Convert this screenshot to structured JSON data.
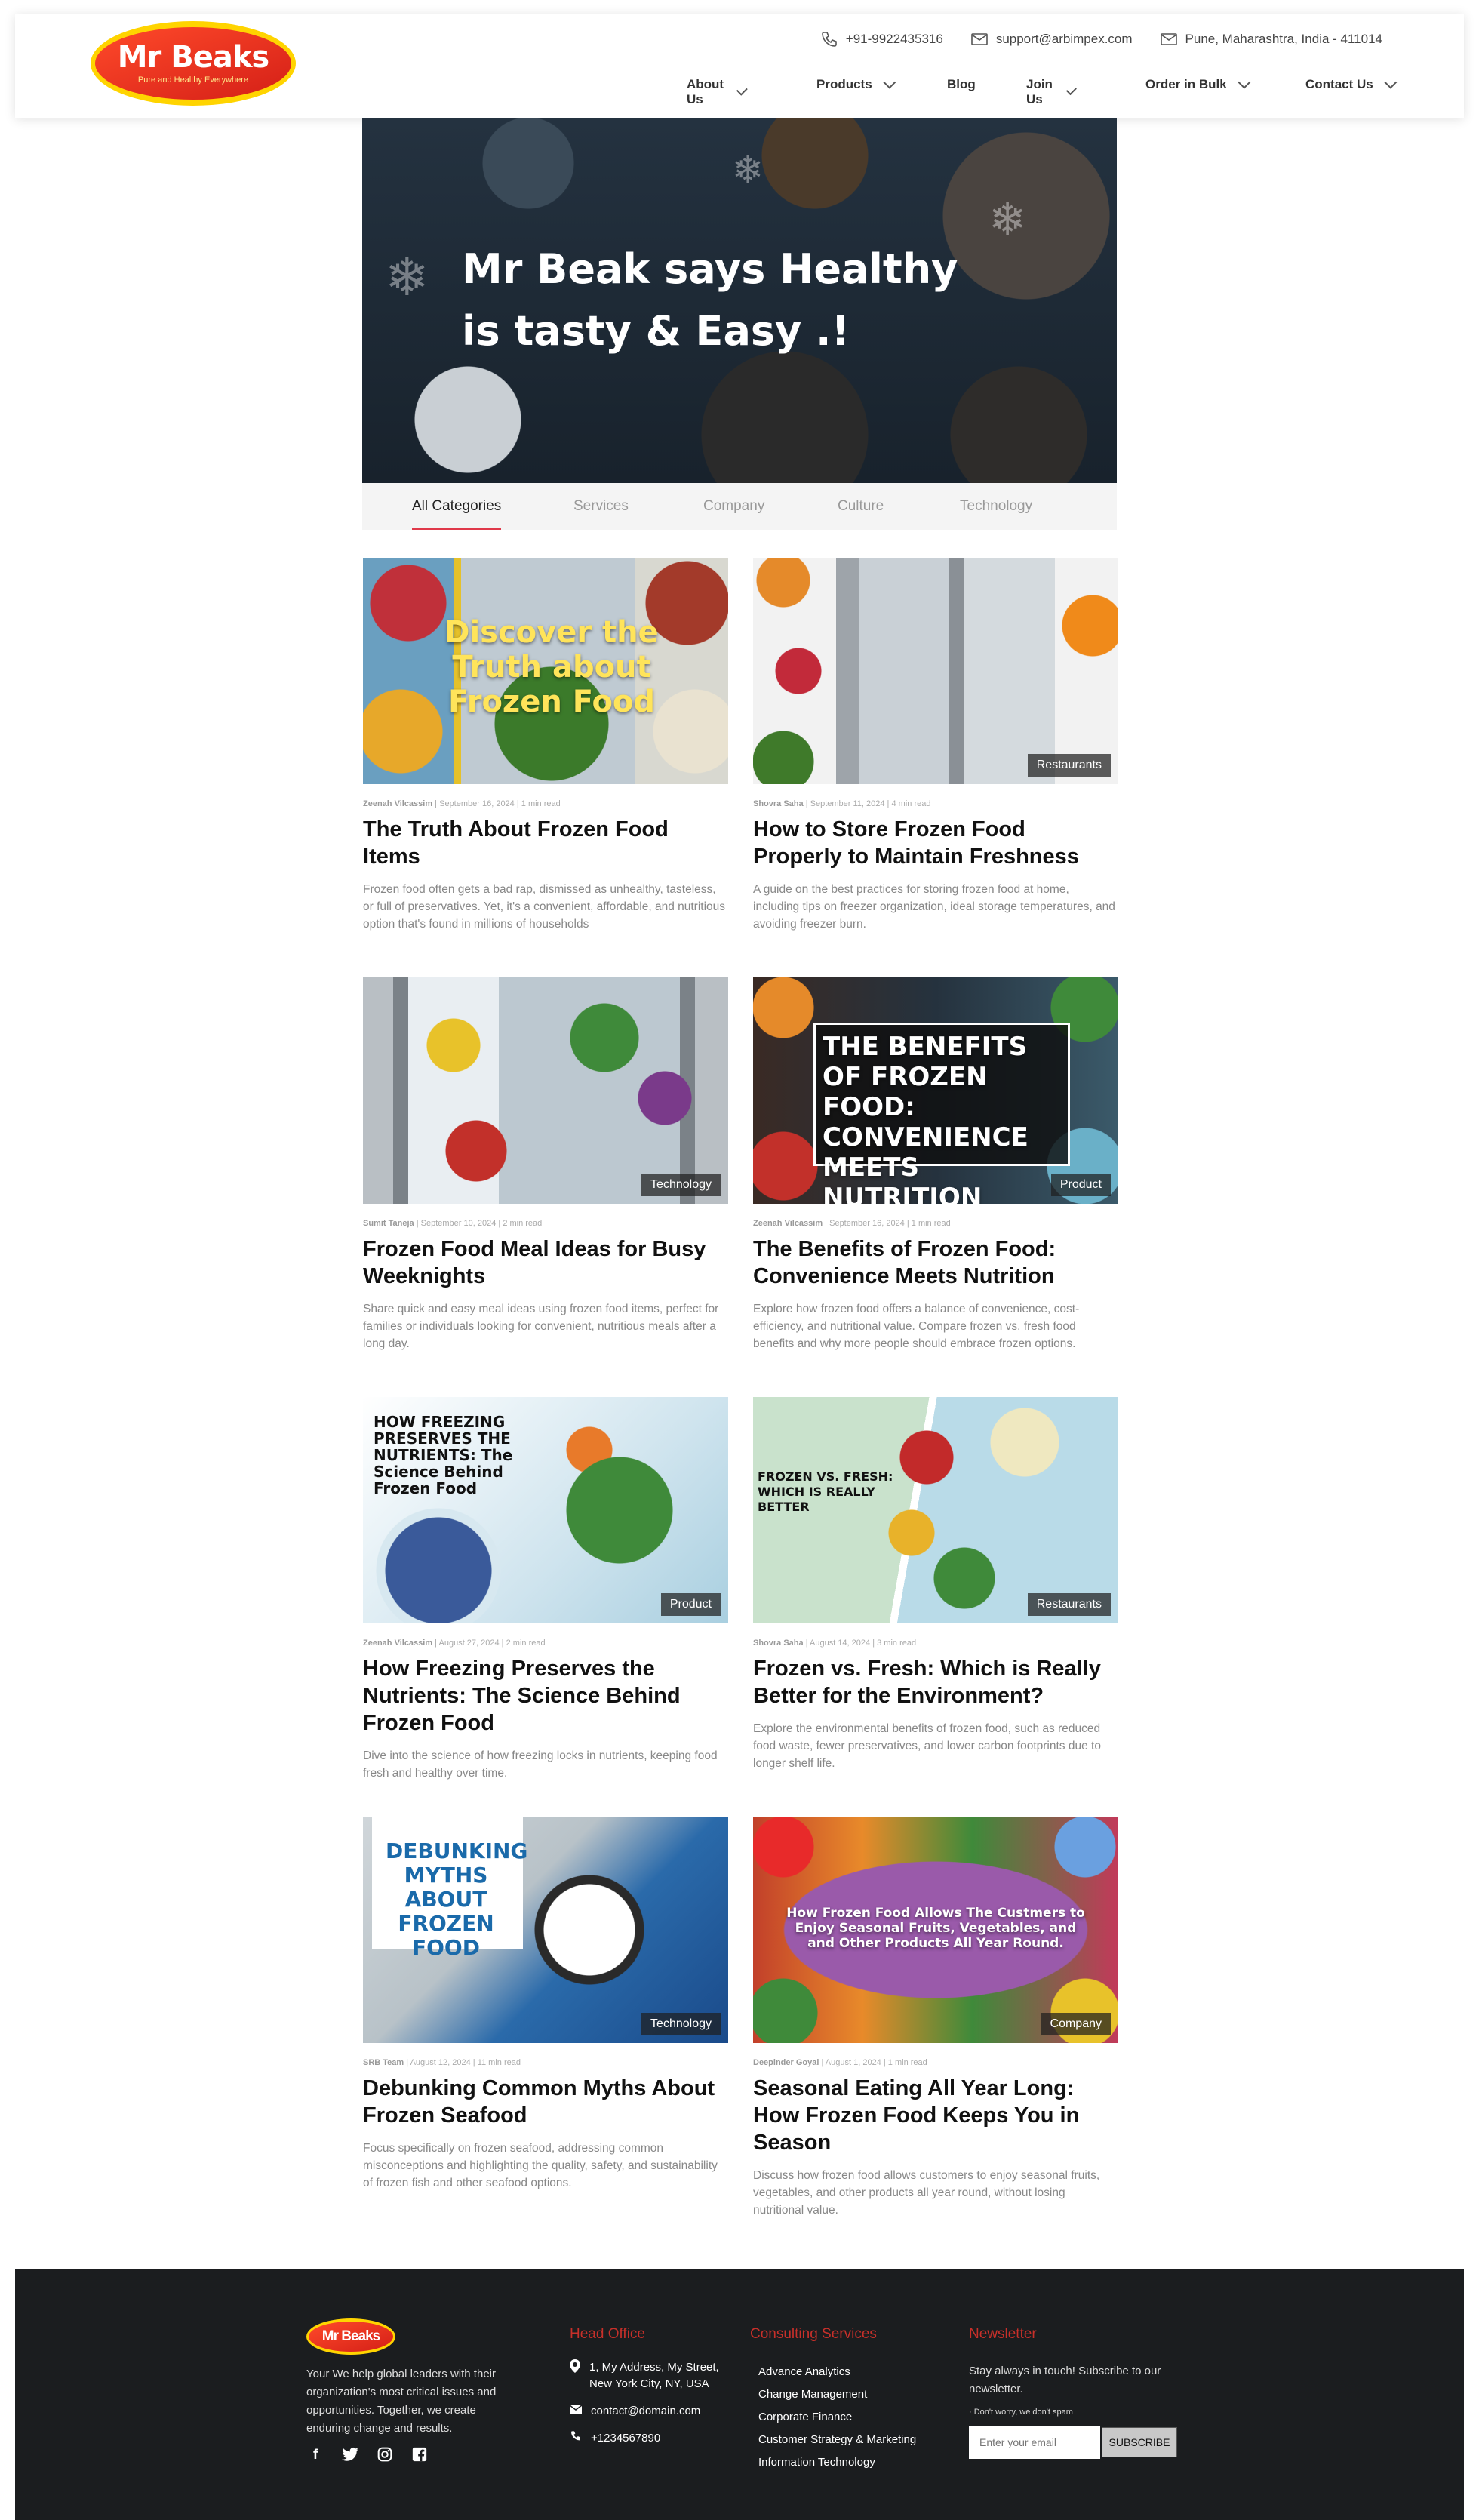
{
  "header": {
    "logo_name": "Mr Beaks",
    "logo_tagline": "Pure and Healthy Everywhere",
    "phone": "+91-9922435316",
    "email": "support@arbimpex.com",
    "location": "Pune, Maharashtra,  India - 411014",
    "nav": [
      {
        "label": "About Us",
        "dropdown": true
      },
      {
        "label": "Products",
        "dropdown": true
      },
      {
        "label": "Blog",
        "dropdown": false
      },
      {
        "label": "Join Us",
        "dropdown": true
      },
      {
        "label": "Order in Bulk",
        "dropdown": true
      },
      {
        "label": "Contact Us",
        "dropdown": true
      }
    ]
  },
  "hero": {
    "heading": "Mr Beak says Healthy is tasty & Easy .!"
  },
  "tabs": [
    "All Categories",
    "Services",
    "Company",
    "Culture",
    "Technology"
  ],
  "posts": [
    {
      "image_text": "Discover the Truth about Frozen Food",
      "badge": "",
      "author": "Zeenah Vilcassim",
      "date": "September 16, 2024",
      "read": "1 min read",
      "title": "The Truth About Frozen Food Items",
      "excerpt": "Frozen food often gets a bad rap, dismissed as unhealthy, tasteless, or full of preservatives. Yet, it's a convenient, affordable, and nutritious option that's found in millions of households"
    },
    {
      "image_text": "",
      "badge": "Restaurants",
      "author": "Shovra Saha",
      "date": "September 11, 2024",
      "read": "4 min read",
      "title": "How to Store Frozen Food Properly to Maintain Freshness",
      "excerpt": "A guide on the best practices for storing frozen food at home, including tips on freezer organization, ideal storage temperatures, and avoiding freezer burn."
    },
    {
      "image_text": "",
      "badge": "Technology",
      "author": "Sumit Taneja",
      "date": "September 10, 2024",
      "read": "2 min read",
      "title": "Frozen Food Meal Ideas for Busy Weeknights",
      "excerpt": "Share quick and easy meal ideas using frozen food items, perfect for families or individuals looking for convenient, nutritious meals after a long day."
    },
    {
      "image_text": "THE BENEFITS OF FROZEN FOOD: CONVENIENCE MEETS NUTRITION",
      "badge": "Product",
      "author": "Zeenah Vilcassim",
      "date": "September 16, 2024",
      "read": "1 min read",
      "title": "The Benefits of Frozen Food: Convenience Meets Nutrition",
      "excerpt": "Explore how frozen food offers a balance of convenience, cost-efficiency, and nutritional value. Compare frozen vs. fresh food benefits and why more people should embrace frozen options."
    },
    {
      "image_text": "HOW FREEZING PRESERVES THE NUTRIENTS: The Science Behind Frozen Food",
      "badge": "Product",
      "author": "Zeenah Vilcassim",
      "date": "August 27, 2024",
      "read": "2 min read",
      "title": "How Freezing Preserves the Nutrients: The Science Behind Frozen Food",
      "excerpt": "Dive into the science of how freezing locks in nutrients, keeping food fresh and healthy over time."
    },
    {
      "image_text": "FROZEN VS. FRESH: WHICH IS REALLY BETTER",
      "badge": "Restaurants",
      "author": "Shovra Saha",
      "date": "August 14, 2024",
      "read": "3 min read",
      "title": "Frozen vs. Fresh: Which is Really Better for the Environment?",
      "excerpt": "Explore the environmental benefits of frozen food, such as reduced food waste, fewer preservatives, and lower carbon footprints due to longer shelf life."
    },
    {
      "image_text": "DEBUNKING MYTHS ABOUT FROZEN FOOD",
      "badge": "Technology",
      "author": "SRB Team",
      "date": "August 12, 2024",
      "read": "11 min read",
      "title": "Debunking Common Myths About Frozen Seafood",
      "excerpt": "Focus specifically on frozen seafood, addressing common misconceptions and highlighting the quality, safety, and sustainability of frozen fish and other seafood options."
    },
    {
      "image_text": "How Frozen Food Allows The Custmers to Enjoy Seasonal Fruits, Vegetables, and and Other Products All Year Round.",
      "badge": "Company",
      "author": "Deepinder Goyal",
      "date": "August 1, 2024",
      "read": "1 min read",
      "title": "Seasonal Eating All Year Long: How Frozen Food Keeps You in Season",
      "excerpt": "Discuss how frozen food allows customers to enjoy seasonal fruits, vegetables, and other products all year round, without losing nutritional value."
    }
  ],
  "footer": {
    "logo": "Mr Beaks",
    "about": "Your We help global leaders with their organization's most critical issues and opportunities. Together, we create enduring change and results.",
    "head_office_title": "Head Office",
    "address": "1, My Address, My Street, New York City, NY, USA",
    "email": "contact@domain.com",
    "phone": "+1234567890",
    "consulting_title": "Consulting Services",
    "consulting_links": [
      "Advance Analytics",
      "Change Management",
      "Corporate Finance",
      "Customer Strategy & Marketing",
      "Information Technology"
    ],
    "newsletter_title": "Newsletter",
    "newsletter_text": "Stay always in touch! Subscribe to our newsletter.",
    "newsletter_note": "Don't worry, we don't spam",
    "email_placeholder": "Enter your email",
    "subscribe_label": "SUBSCRIBE"
  },
  "colors": {
    "accent": "#e0394a",
    "brand_red": "#d41f17",
    "brand_yellow": "#ffd400",
    "footer_bg": "#1b1d1f",
    "footer_heading": "#c8302a"
  }
}
